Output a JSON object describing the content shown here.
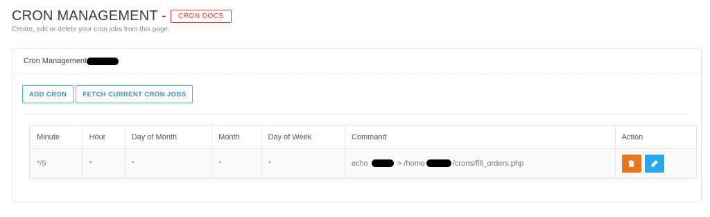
{
  "header": {
    "title": "CRON MANAGEMENT -",
    "docs_label": "CRON DOCS",
    "subtitle": "Create, edit or delete your cron jobs from this page."
  },
  "panel": {
    "heading": "Cron Management",
    "buttons": {
      "add": "ADD CRON",
      "fetch": "FETCH CURRENT CRON JOBS"
    }
  },
  "table": {
    "columns": [
      "Minute",
      "Hour",
      "Day of Month",
      "Month",
      "Day of Week",
      "Command",
      "Action"
    ],
    "rows": [
      {
        "minute": "*/5",
        "hour": "*",
        "day_of_month": "*",
        "month": "*",
        "day_of_week": "*",
        "command_prefix": "echo",
        "command_mid": "> /home",
        "command_suffix": "/crons/fill_orders.php"
      }
    ]
  },
  "colors": {
    "accent_red": "#e53935",
    "button_blue": "#42b3e5",
    "delete_orange": "#e8771c",
    "edit_blue": "#29a8e8"
  },
  "icons": [
    "trash-icon",
    "pencil-icon"
  ]
}
